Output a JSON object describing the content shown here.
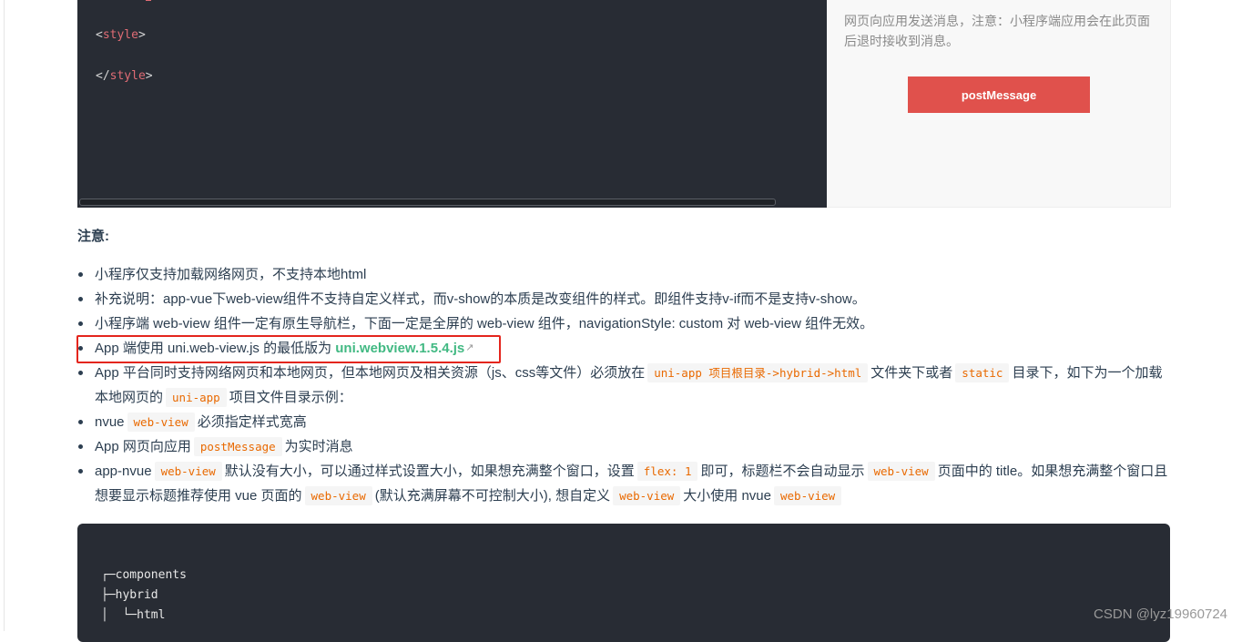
{
  "demo": {
    "code_lines": [
      {
        "open": "<",
        "tag": "style",
        "close": ">"
      },
      {
        "open": "</",
        "tag": "style",
        "close": ">"
      }
    ],
    "preview_desc": "网页向应用发送消息，注意：小程序端应用会在此页面后退时接收到消息。",
    "button_label": "postMessage"
  },
  "notice_title": "注意:",
  "notes": {
    "n1": "小程序仅支持加载网络网页，不支持本地html",
    "n2": "补充说明：app-vue下web-view组件不支持自定义样式，而v-show的本质是改变组件的样式。即组件支持v-if而不是支持v-show。",
    "n3": "小程序端 web-view 组件一定有原生导航栏，下面一定是全屏的 web-view 组件，navigationStyle: custom 对 web-view 组件无效。",
    "n4": {
      "text": "App 端使用 uni.web-view.js 的最低版为 ",
      "link": "uni.webview.1.5.4.js"
    },
    "n5": {
      "a": "App 平台同时支持网络网页和本地网页，但本地网页及相关资源（js、css等文件）必须放在",
      "code1": "uni-app 项目根目录->hybrid->html",
      "b": "文件夹下或者",
      "code2": "static",
      "c": "目录下，如下为一个加载本地网页的",
      "code3": "uni-app",
      "d": "项目文件目录示例："
    },
    "n6": {
      "a": "nvue",
      "code": "web-view",
      "b": "必须指定样式宽高"
    },
    "n7": {
      "a": "App 网页向应用",
      "code": "postMessage",
      "b": "为实时消息"
    },
    "n8": {
      "a": "app-nvue",
      "code1": "web-view",
      "b": "默认没有大小，可以通过样式设置大小，如果想充满整个窗口，设置",
      "code2": "flex: 1",
      "c": "即可，标题栏不会自动显示",
      "code3": "web-view",
      "d": "页面中的 title。如果想充满整个窗口且想要显示标题推荐使用 vue 页面的",
      "code4": "web-view",
      "e": "(默认充满屏幕不可控制大小), 想自定义",
      "code5": "web-view",
      "f": "大小使用 nvue",
      "code6": "web-view"
    }
  },
  "tree": {
    "lines": [
      "┌─components",
      "├─hybrid",
      "│  └─html"
    ]
  },
  "watermark": "CSDN @lyz19960724"
}
